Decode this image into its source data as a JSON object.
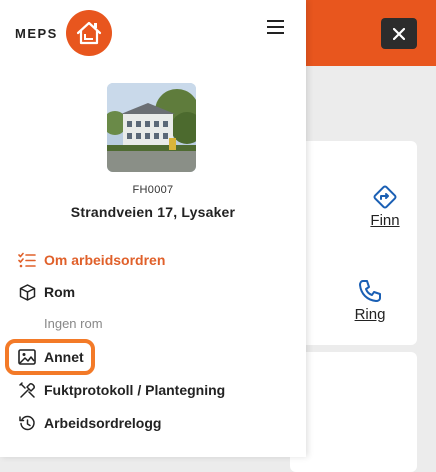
{
  "brand": {
    "name": "MEPS",
    "color": "#e8561e"
  },
  "background": {
    "close_icon": "close-icon",
    "actions": [
      {
        "label": "Finn",
        "icon": "directions-icon"
      },
      {
        "label": "Ring",
        "icon": "phone-icon"
      }
    ]
  },
  "property": {
    "code": "FH0007",
    "address": "Strandveien 17, Lysaker"
  },
  "nav": {
    "items": [
      {
        "label": "Om arbeidsordren",
        "icon": "checklist-icon",
        "active": true
      },
      {
        "label": "Rom",
        "icon": "cube-icon"
      },
      {
        "label": "Annet",
        "icon": "image-icon",
        "highlighted": true
      },
      {
        "label": "Fuktprotokoll / Plantegning",
        "icon": "tools-icon"
      },
      {
        "label": "Arbeidsordrelogg",
        "icon": "history-icon"
      }
    ],
    "rom_empty": "Ingen rom"
  },
  "colors": {
    "accent": "#e0602a",
    "highlight": "#f37a28",
    "header": "#e8561e"
  }
}
